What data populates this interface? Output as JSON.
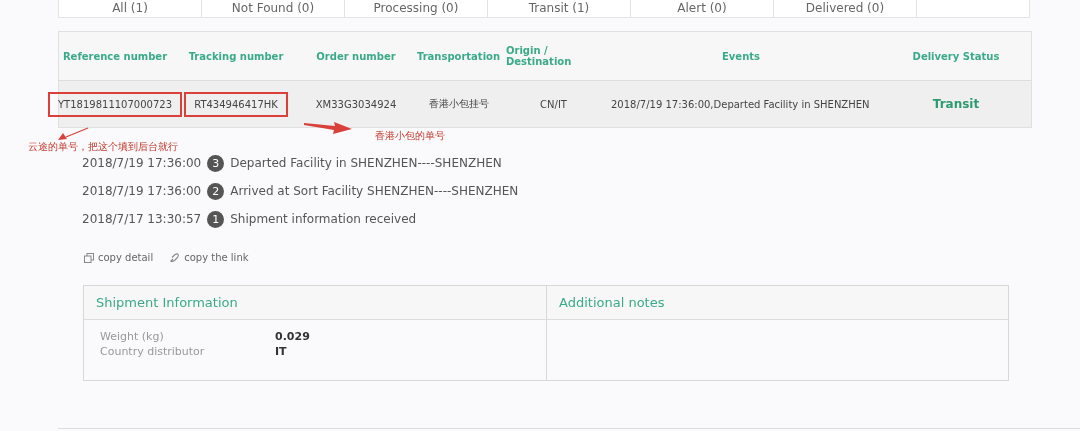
{
  "tabs": [
    {
      "label": "All (1)"
    },
    {
      "label": "Not Found (0)"
    },
    {
      "label": "Processing (0)"
    },
    {
      "label": "Transit (1)"
    },
    {
      "label": "Alert (0)"
    },
    {
      "label": "Delivered (0)"
    }
  ],
  "table": {
    "columns": [
      "Reference number",
      "Tracking number",
      "Order number",
      "Transportation",
      "Origin / Destination",
      "Events",
      "Delivery Status"
    ],
    "rows": [
      {
        "cells": [
          {
            "text": "YT1819811107000723",
            "circled": true
          },
          {
            "text": "RT434946417HK",
            "circled": true
          },
          {
            "text": "XM33G3034924",
            "circled": false
          },
          {
            "text": "香港小包挂号",
            "circled": false
          },
          {
            "text": "CN/IT",
            "circled": false
          },
          {
            "text": "2018/7/19 17:36:00,Departed Facility in SHENZHEN",
            "circled": false
          },
          {
            "text": "Transit",
            "circled": false,
            "kind": "status"
          }
        ]
      }
    ]
  },
  "annotations": [
    {
      "text": "云途的单号，把这个填到后台就行"
    },
    {
      "text": "香港小包的单号"
    }
  ],
  "events": [
    {
      "time": "2018/7/19 17:36:00",
      "step": "3",
      "text": "Departed Facility in SHENZHEN----SHENZHEN"
    },
    {
      "time": "2018/7/19 17:36:00",
      "step": "2",
      "text": "Arrived at Sort Facility SHENZHEN----SHENZHEN"
    },
    {
      "time": "2018/7/17 13:30:57",
      "step": "1",
      "text": "Shipment information received"
    }
  ],
  "actions": [
    {
      "kind": "copy",
      "label": "copy detail"
    },
    {
      "kind": "link",
      "label": "copy the link"
    }
  ],
  "shipment_info": {
    "title": "Shipment Information",
    "fields": [
      {
        "label": "Weight (kg)",
        "value": "0.029"
      },
      {
        "label": "Country distributor",
        "value": "IT"
      }
    ]
  },
  "additional_notes": {
    "title": "Additional notes"
  }
}
